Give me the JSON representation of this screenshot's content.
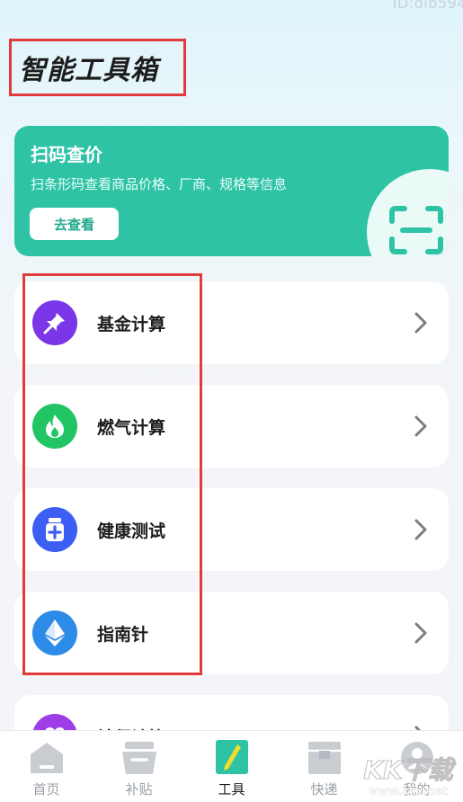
{
  "watermark_top": "ID:dib594",
  "page_title": "智能工具箱",
  "scan_card": {
    "title": "扫码查价",
    "description": "扫条形码查看商品价格、厂商、规格等信息",
    "button_label": "去查看",
    "icon": "scan-frame-icon"
  },
  "tools": [
    {
      "label": "基金计算",
      "icon": "pushpin-icon",
      "color": "#7a36e8"
    },
    {
      "label": "燃气计算",
      "icon": "flame-icon",
      "color": "#21c563"
    },
    {
      "label": "健康测试",
      "icon": "medicine-bottle-icon",
      "color": "#3d5ef2"
    },
    {
      "label": "指南针",
      "icon": "compass-diamond-icon",
      "color": "#2d8be8"
    },
    {
      "label": "社保计算",
      "icon": "heart-icon",
      "color": "#9d3ee8"
    }
  ],
  "tabbar": {
    "items": [
      {
        "label": "首页",
        "icon": "home-icon",
        "active": false
      },
      {
        "label": "补贴",
        "icon": "basket-icon",
        "active": false
      },
      {
        "label": "工具",
        "icon": "pen-tool-icon",
        "active": true
      },
      {
        "label": "快递",
        "icon": "box-icon",
        "active": false
      },
      {
        "label": "我的",
        "icon": "profile-icon",
        "active": false
      }
    ]
  },
  "watermark": {
    "logo_text": "KK下载",
    "url": "www.kkx.net"
  },
  "colors": {
    "accent": "#2fc3a6",
    "highlight": "#e23b3b"
  }
}
